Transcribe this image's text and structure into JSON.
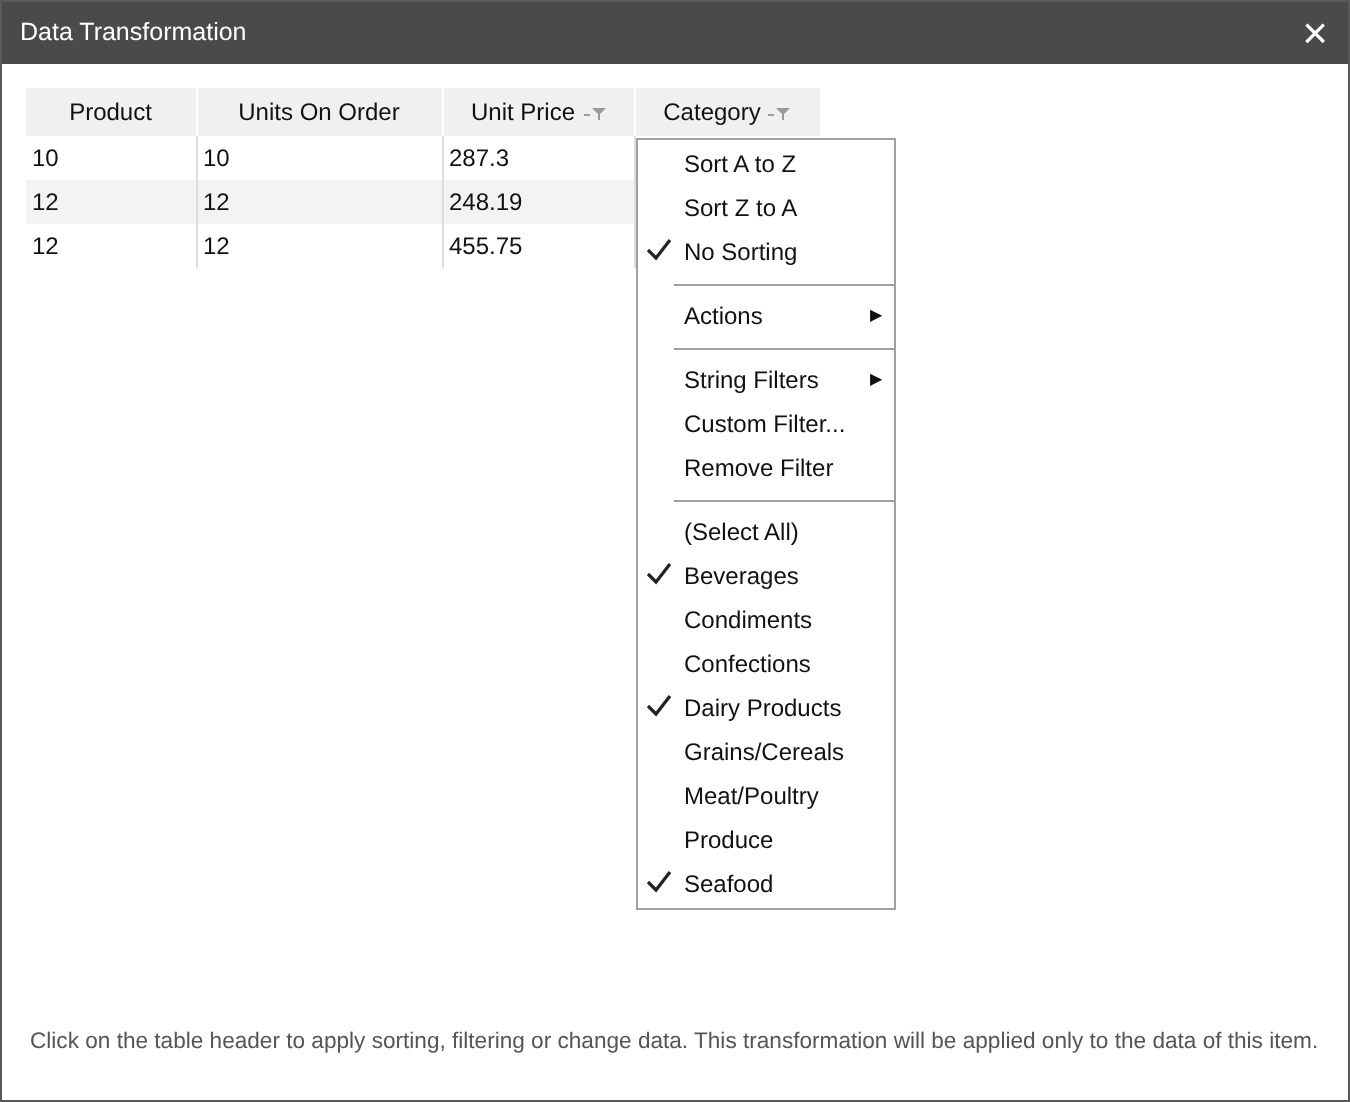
{
  "window": {
    "title": "Data Transformation",
    "close": "×"
  },
  "table": {
    "columns": [
      {
        "label": "Product",
        "filter": false
      },
      {
        "label": "Units On Order",
        "filter": false
      },
      {
        "label": "Unit Price",
        "filter": true
      },
      {
        "label": "Category",
        "filter": true
      }
    ],
    "rows": [
      [
        "10",
        "10",
        "287.3"
      ],
      [
        "12",
        "12",
        "248.19"
      ],
      [
        "12",
        "12",
        "455.75"
      ]
    ]
  },
  "menu": {
    "items": [
      {
        "kind": "item",
        "label": "Sort A to Z",
        "checked": false
      },
      {
        "kind": "item",
        "label": "Sort Z to A",
        "checked": false
      },
      {
        "kind": "item",
        "label": "No Sorting",
        "checked": true
      },
      {
        "kind": "separator"
      },
      {
        "kind": "submenu",
        "label": "Actions",
        "arrow": "▶"
      },
      {
        "kind": "separator"
      },
      {
        "kind": "submenu",
        "label": "String Filters",
        "arrow": "▶"
      },
      {
        "kind": "item",
        "label": "Custom Filter...",
        "checked": false
      },
      {
        "kind": "item",
        "label": "Remove Filter",
        "checked": false
      },
      {
        "kind": "separator"
      },
      {
        "kind": "item",
        "label": "(Select All)",
        "checked": false
      },
      {
        "kind": "item",
        "label": "Beverages",
        "checked": true
      },
      {
        "kind": "item",
        "label": "Condiments",
        "checked": false
      },
      {
        "kind": "item",
        "label": "Confections",
        "checked": false
      },
      {
        "kind": "item",
        "label": "Dairy Products",
        "checked": true
      },
      {
        "kind": "item",
        "label": "Grains/Cereals",
        "checked": false
      },
      {
        "kind": "item",
        "label": "Meat/Poultry",
        "checked": false
      },
      {
        "kind": "item",
        "label": "Produce",
        "checked": false
      },
      {
        "kind": "item",
        "label": "Seafood",
        "checked": true
      }
    ]
  },
  "hint": "Click on the table header to apply sorting, filtering or change data. This transformation will be applied only to the data of this item."
}
